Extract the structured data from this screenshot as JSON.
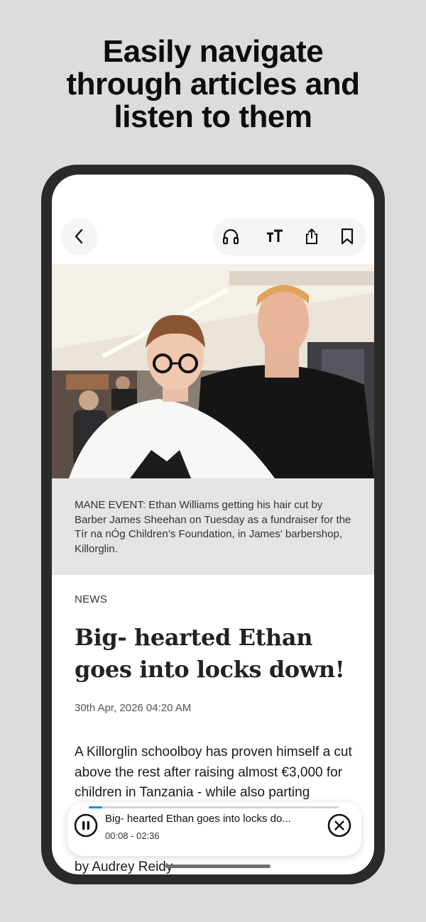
{
  "promo": {
    "headline_line1": "Easily navigate",
    "headline_line2": "through articles and",
    "headline_line3": "listen to them"
  },
  "toolbar": {
    "back_icon": "chevron-left-icon",
    "actions": [
      "headphones-icon",
      "text-size-icon",
      "share-icon",
      "bookmark-icon"
    ]
  },
  "article": {
    "caption": "MANE EVENT: Ethan Williams getting his hair cut by Barber James Sheehan on Tuesday as a fundraiser for the Tír na nÓg Children’s Foundation, in James' barbershop, Killorglin.",
    "category": "NEWS",
    "title": "Big- hearted Ethan goes into locks down!",
    "date": "30th Apr, 2026 04:20 AM",
    "body": "A Killorglin schoolboy has proven himself a cut above the rest after raising almost €3,000 for children in Tanzania - while also parting",
    "byline": "by Audrey Reidy"
  },
  "player": {
    "title": "Big- hearted Ethan goes into locks do...",
    "time": "00:08 - 02:36",
    "progress": 0.055,
    "accent_color": "#1a8fd8",
    "pause_icon": "pause-icon",
    "close_icon": "close-circle-icon"
  }
}
